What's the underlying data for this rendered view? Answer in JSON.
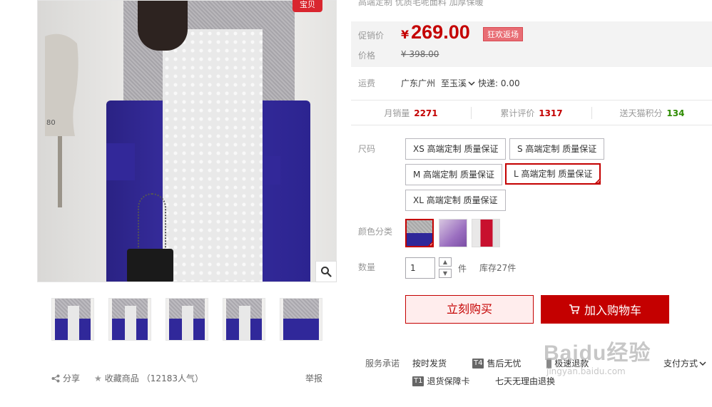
{
  "gallery": {
    "badge": "宝贝",
    "thumbnail_count": 5
  },
  "share": {
    "share_label": "分享",
    "favorite_label": "收藏商品",
    "popularity": "（12183人气）",
    "report_label": "举报"
  },
  "product": {
    "subtitle": "高端定制 优质毛呢面料 加厚保暖"
  },
  "price": {
    "promo_label": "促销价",
    "currency": "¥",
    "promo_value": "269.00",
    "event_tag": "狂欢返场",
    "orig_label": "价格",
    "orig_value": "¥ 398.00"
  },
  "shipping": {
    "label": "运费",
    "from": "广东广州",
    "to": "至玉溪",
    "fee": "快递: 0.00"
  },
  "stats": {
    "monthly_sales_label": "月销量",
    "monthly_sales": "2271",
    "reviews_label": "累计评价",
    "reviews": "1317",
    "points_label": "送天猫积分",
    "points": "134"
  },
  "sizes": {
    "label": "尺码",
    "options": [
      "XS 高端定制 质量保证",
      "S 高端定制 质量保证",
      "M 高端定制 质量保证",
      "L 高端定制 质量保证",
      "XL 高端定制 质量保证"
    ],
    "selected": "L 高端定制 质量保证"
  },
  "colors": {
    "label": "颜色分类",
    "selected_index": 0
  },
  "quantity": {
    "label": "数量",
    "value": "1",
    "unit": "件",
    "stock": "库存27件"
  },
  "actions": {
    "buy_now": "立刻购买",
    "add_cart": "加入购物车"
  },
  "services": {
    "label": "服务承诺",
    "items": [
      {
        "text": "按时发货",
        "icon": ""
      },
      {
        "text": "售后无忧",
        "icon": "T4"
      },
      {
        "text": "极速退款",
        "icon": ""
      },
      {
        "text": "退货保障卡",
        "icon": "T1"
      },
      {
        "text": "七天无理由退换",
        "icon": ""
      }
    ],
    "pay_method": "支付方式"
  },
  "watermark": {
    "main": "Baidu经验",
    "sub": "jingyan.baidu.com"
  },
  "colors_palette": {
    "accent_red": "#c40000",
    "price_bg": "#f3f3f3",
    "event_tag_bg": "#e86d74",
    "green": "#2d8b00"
  },
  "icons": {
    "zoom": "magnifier-icon",
    "share": "share-icon",
    "favorite": "star-icon",
    "cart": "cart-icon",
    "chevron": "chevron-down-icon"
  }
}
